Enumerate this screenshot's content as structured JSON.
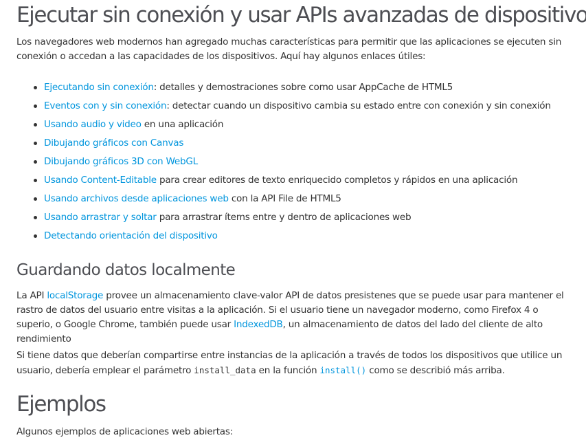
{
  "heading_main": "Ejecutar sin conexión y usar APIs avanzadas de dispositivos",
  "intro": "Los navegadores web modernos han agregado muchas características para permitir que las aplicaciones se ejecuten sin conexión o accedan a las capacidades de los dispositivos. Aquí hay algunos enlaces útiles:",
  "links": [
    {
      "link": "Ejecutando sin conexión",
      "text": ": detalles y demostraciones sobre como usar AppCache de HTML5"
    },
    {
      "link": "Eventos con y sin conexión",
      "text": ": detectar cuando un dispositivo cambia su estado entre con conexión y sin conexión"
    },
    {
      "link": "Usando audio y video",
      "text": " en una aplicación"
    },
    {
      "link": "Dibujando gráficos con Canvas",
      "text": ""
    },
    {
      "link": "Dibujando gráficos 3D con WebGL",
      "text": ""
    },
    {
      "link": "Usando Content-Editable",
      "text": " para crear editores de texto enriquecido completos y rápidos en una aplicación"
    },
    {
      "link": "Usando archivos desde aplicaciones web",
      "text": " con la API File de HTML5"
    },
    {
      "link": "Usando arrastrar y soltar",
      "text": " para arrastrar ítems entre y dentro de aplicaciones web"
    },
    {
      "link": "Detectando orientación del dispositivo",
      "text": ""
    }
  ],
  "heading_storage": "Guardando datos localmente",
  "storage": {
    "t1": "La API ",
    "link1": "localStorage",
    "t2": " provee un almacenamiento clave-valor API de datos presistenes que se puede usar para mantener el rastro de datos del usuario entre visitas a la aplicación. Si el usuario tiene un navegador moderno, como Firefox 4 o superio, o Google Chrome, también puede usar ",
    "link2": "IndexedDB",
    "t3": ", un almacenamiento de datos del lado del cliente de alto rendimiento"
  },
  "share": {
    "t1": "Si tiene datos que deberían compartirse entre instancias de la aplicación a través de todos los dispositivos que utilice un usuario, debería emplear el parámetro ",
    "code1": "install_data",
    "t2": " en la función ",
    "code2": "install()",
    "t3": " como se describió más arriba."
  },
  "heading_examples": "Ejemplos",
  "examples_intro": "Algunos ejemplos de aplicaciones web abiertas:"
}
